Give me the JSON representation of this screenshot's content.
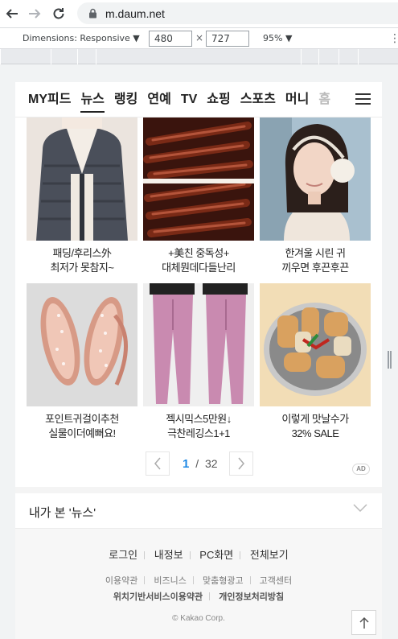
{
  "browser": {
    "url": "m.daum.net",
    "devtools": {
      "dimensions_label": "Dimensions: Responsive ▼",
      "width": "480",
      "height": "727",
      "times": "×",
      "zoom": "95% ▼"
    }
  },
  "gnb": {
    "items": [
      "MY피드",
      "뉴스",
      "랭킹",
      "연예",
      "TV",
      "쇼핑",
      "스포츠",
      "머니",
      "홈"
    ],
    "active_index": 1
  },
  "products": [
    {
      "line1": "패딩/후리스外",
      "line2": "최저가 못참지~",
      "image": "padded-jacket-photo"
    },
    {
      "line1": "+美친 중독성+",
      "line2": "대체뭔데다들난리",
      "image": "dried-squid-photo"
    },
    {
      "line1": "한겨울 시린 귀",
      "line2": "끼우면 후끈후끈",
      "image": "earmuff-model-photo"
    },
    {
      "line1": "포인트귀걸이추천",
      "line2": "실물이더예뻐요!",
      "image": "rose-gold-earrings-photo"
    },
    {
      "line1": "젝시믹스5만원↓",
      "line2": "극찬레깅스1+1",
      "image": "pink-leggings-photo"
    },
    {
      "line1": "이렇게 맛날수가",
      "line2": "32% SALE",
      "image": "fish-cake-photo"
    }
  ],
  "pager": {
    "current": "1",
    "separator": "/",
    "total": "32",
    "ad_label": "AD"
  },
  "viewed": {
    "title": "내가 본 '뉴스'"
  },
  "footer": {
    "row1": [
      "로그인",
      "내정보",
      "PC화면",
      "전체보기"
    ],
    "row2": [
      "이용약관",
      "비즈니스",
      "맞춤형광고",
      "고객센터"
    ],
    "row3": [
      "위치기반서비스이용약관",
      "개인정보처리방침"
    ],
    "copyright": "© Kakao Corp."
  },
  "colors": {
    "accent_blue": "#1e88e5",
    "text": "#222222"
  }
}
